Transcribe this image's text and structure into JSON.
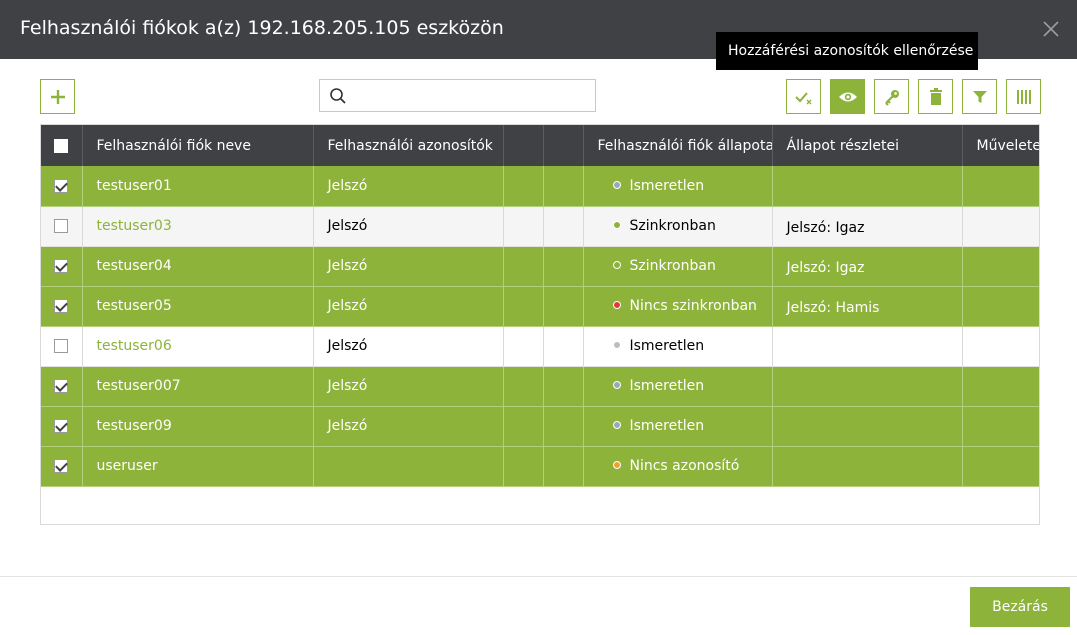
{
  "dialog": {
    "title": "Felhasználói fiókok a(z) 192.168.205.105 eszközön"
  },
  "tooltip": "Hozzáférési azonosítók ellenőrzése",
  "toolbar": {
    "add_icon": "plus-icon",
    "search_placeholder": "",
    "search_icon": "search-icon",
    "buttons": [
      {
        "name": "check-credentials-icon",
        "active": false
      },
      {
        "name": "eye-icon",
        "active": true
      },
      {
        "name": "key-icon",
        "active": false
      },
      {
        "name": "trash-icon",
        "active": false
      },
      {
        "name": "filter-icon",
        "active": false
      },
      {
        "name": "columns-icon",
        "active": false
      }
    ]
  },
  "colors": {
    "accent": "#8db33a",
    "header_bg": "#3f4144",
    "status_unknown": "#9aa7b5",
    "status_synced": "#8db33a",
    "status_unsynced": "#e53935",
    "status_no_credential": "#f0a030",
    "status_unknown_plain": "#bdbdbd"
  },
  "table": {
    "columns": [
      "",
      "Felhasználói fiók neve",
      "Felhasználói azonosítók",
      "",
      "",
      "Felhasználói fiók állapota",
      "Állapot részletei",
      "Műveletek"
    ],
    "rows": [
      {
        "checked": true,
        "name": "testuser01",
        "credential": "Jelszó",
        "status": "Ismeretlen",
        "status_color": "#9aa7b5",
        "details": ""
      },
      {
        "checked": false,
        "name": "testuser03",
        "credential": "Jelszó",
        "status": "Szinkronban",
        "status_color": "#8db33a",
        "details": "Jelszó: Igaz"
      },
      {
        "checked": true,
        "name": "testuser04",
        "credential": "Jelszó",
        "status": "Szinkronban",
        "status_color": "#8db33a",
        "details": "Jelszó: Igaz"
      },
      {
        "checked": true,
        "name": "testuser05",
        "credential": "Jelszó",
        "status": "Nincs szinkronban",
        "status_color": "#e53935",
        "details": "Jelszó: Hamis"
      },
      {
        "checked": false,
        "name": "testuser06",
        "credential": "Jelszó",
        "status": "Ismeretlen",
        "status_color": "#bdbdbd",
        "details": ""
      },
      {
        "checked": true,
        "name": "testuser007",
        "credential": "Jelszó",
        "status": "Ismeretlen",
        "status_color": "#9aa7b5",
        "details": ""
      },
      {
        "checked": true,
        "name": "testuser09",
        "credential": "Jelszó",
        "status": "Ismeretlen",
        "status_color": "#9aa7b5",
        "details": ""
      },
      {
        "checked": true,
        "name": "useruser",
        "credential": "",
        "status": "Nincs azonosító",
        "status_color": "#f0a030",
        "details": ""
      }
    ]
  },
  "footer": {
    "close_label": "Bezárás"
  }
}
